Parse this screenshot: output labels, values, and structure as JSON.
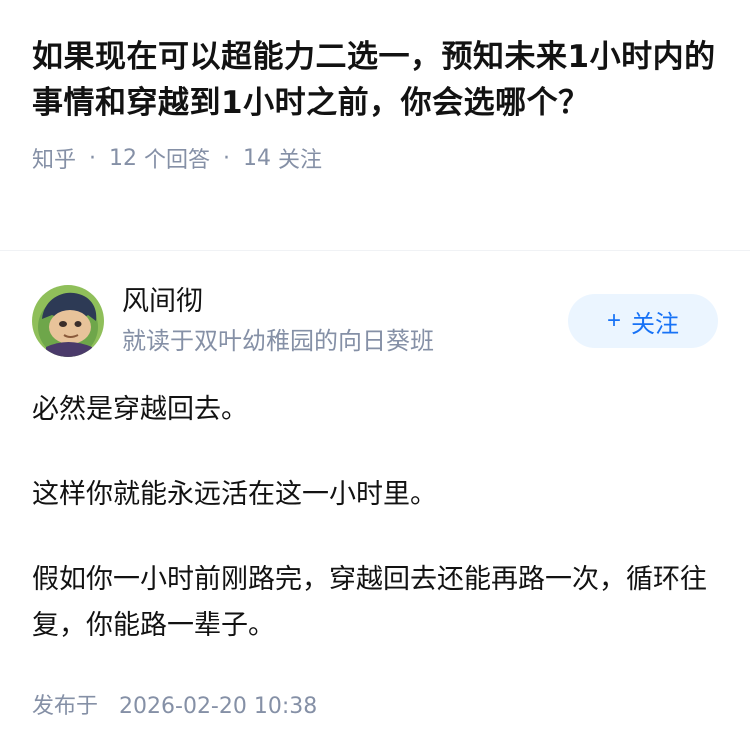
{
  "question": {
    "title": "如果现在可以超能力二选一，预知未来1小时内的事情和穿越到1小时之前，你会选哪个？",
    "source": "知乎",
    "answer_count": "12",
    "answer_label": "个回答",
    "follower_count": "14",
    "follower_label": "关注"
  },
  "answer": {
    "author": {
      "name": "风间彻",
      "bio": "就读于双叶幼稚园的向日葵班",
      "avatar_icon": "cartoon-avatar"
    },
    "follow_button": {
      "plus": "+",
      "label": "关注"
    },
    "paragraphs": [
      "必然是穿越回去。",
      "这样你就能永远活在这一小时里。",
      "假如你一小时前刚路完，穿越回去还能再路一次，循环往复，你能路一辈子。"
    ],
    "publish_label": "发布于",
    "publish_time": "2026-02-20 10:38"
  },
  "colors": {
    "meta_gray": "#8590a6",
    "follow_bg": "#ebf5ff",
    "follow_text": "#1772f6"
  }
}
